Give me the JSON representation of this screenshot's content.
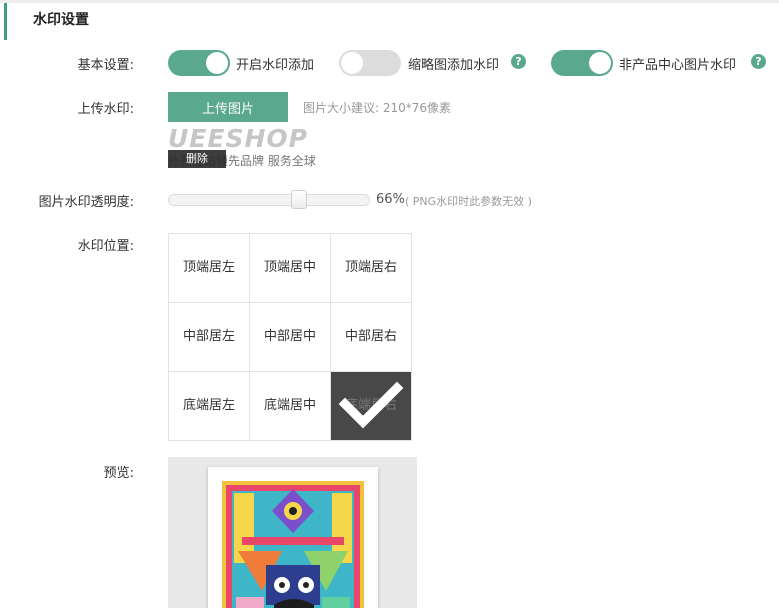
{
  "section": {
    "title": "水印设置"
  },
  "basic": {
    "label": "基本设置:",
    "toggles": [
      {
        "label": "开启水印添加",
        "state": "on"
      },
      {
        "label": "缩略图添加水印",
        "state": "off",
        "help_icon": "question-icon"
      },
      {
        "label": "非产品中心图片水印",
        "state": "on",
        "help_icon": "question-icon"
      }
    ]
  },
  "upload": {
    "label": "上传水印:",
    "button": "上传图片",
    "hint": "图片大小建议: 210*76像素",
    "watermark_logo": "UEESHOP",
    "watermark_tagline": "外贸建站领先品牌 服务全球",
    "delete_label": "删除"
  },
  "opacity": {
    "label": "图片水印透明度:",
    "value": "66%",
    "value_fraction": 0.66,
    "note": "( PNG水印时此参数无效 )"
  },
  "position": {
    "label": "水印位置:",
    "cells": [
      "顶端居左",
      "顶端居中",
      "顶端居右",
      "中部居左",
      "中部居中",
      "中部居右",
      "底端居左",
      "底端居中",
      "底端居右"
    ],
    "selected_index": 8,
    "selected_icon": "checkmark-icon"
  },
  "preview": {
    "label": "预览:"
  },
  "colors": {
    "accent": "#5aa88d",
    "toggle_off": "#dcdcdc",
    "selected_cell": "#484848"
  }
}
